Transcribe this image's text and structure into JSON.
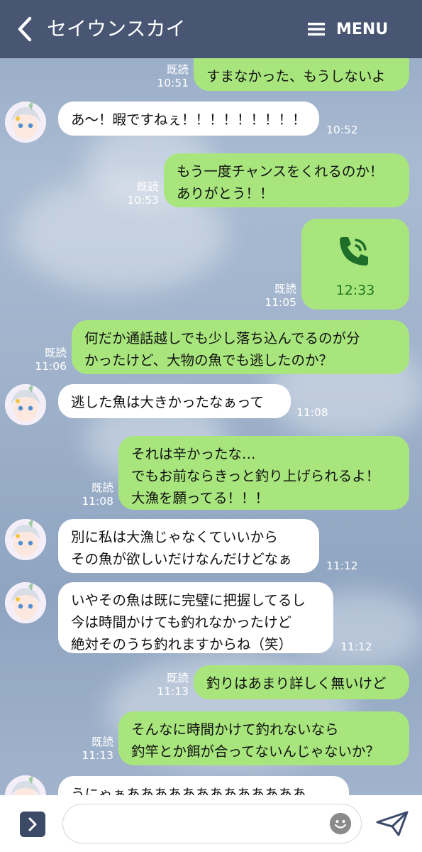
{
  "header": {
    "title": "セイウンスカイ",
    "menu_label": "MENU"
  },
  "messages": [
    {
      "type": "outgoing",
      "read_label": "既読",
      "time": "10:51",
      "text": "すまなかった、もうしないよ"
    },
    {
      "type": "incoming",
      "time": "10:52",
      "text": "あ〜！暇ですねぇ！！！！！！！！！"
    },
    {
      "type": "outgoing",
      "read_label": "既読",
      "time": "10:53",
      "text": "もう一度チャンスをくれるのか！\nありがとう！！"
    },
    {
      "type": "call",
      "read_label": "既読",
      "time": "11:05",
      "call_duration": "12:33",
      "icon": "phone-call-icon"
    },
    {
      "type": "outgoing",
      "read_label": "既読",
      "time": "11:06",
      "text": "何だか通話越しでも少し落ち込んでるのが分\nかったけど、大物の魚でも逃したのか？"
    },
    {
      "type": "incoming",
      "time": "11:08",
      "text": "逃した魚は大きかったなぁって"
    },
    {
      "type": "outgoing",
      "read_label": "既読",
      "time": "11:08",
      "text": "それは辛かったな…\nでもお前ならきっと釣り上げられるよ！\n大漁を願ってる！！！"
    },
    {
      "type": "incoming",
      "time": "11:12",
      "text": "別に私は大漁じゃなくていいから\nその魚が欲しいだけなんだけどなぁ"
    },
    {
      "type": "incoming",
      "time": "11:12",
      "text": "いやその魚は既に完璧に把握してるし\n今は時間かけても釣れなかったけど\n絶対そのうち釣れますからね（笑）"
    },
    {
      "type": "outgoing",
      "read_label": "既読",
      "time": "11:13",
      "text": "釣りはあまり詳しく無いけど"
    },
    {
      "type": "outgoing",
      "read_label": "既読",
      "time": "11:13",
      "text": "そんなに時間かけて釣れないなら\n釣竿とか餌が合ってないんじゃないか？"
    },
    {
      "type": "incoming",
      "time": "",
      "text": "うにゃぁあああああああああああああ"
    }
  ],
  "footer": {
    "input_placeholder": ""
  },
  "colors": {
    "header_bg": "#485673",
    "outgoing_bubble": "#a8e67d",
    "incoming_bubble": "#ffffff",
    "call_time": "#1f7a1f"
  }
}
